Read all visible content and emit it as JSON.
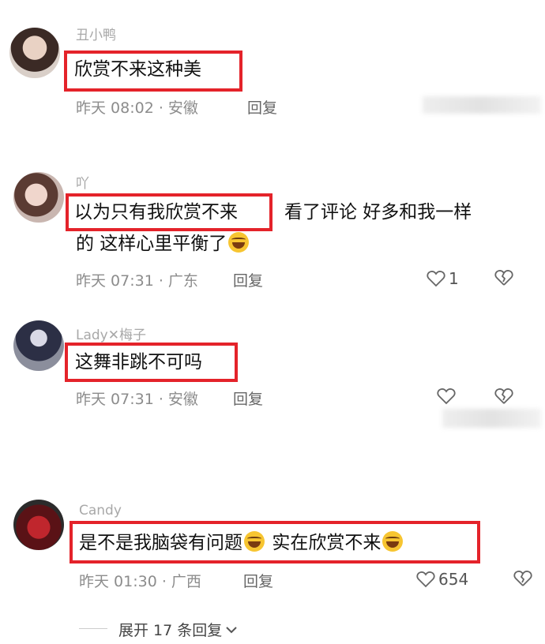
{
  "comments": [
    {
      "username": "丑小鸭",
      "line1_highlight": "欣赏不来这种美",
      "line1_rest": "",
      "line2": "",
      "time": "昨天 08:02 · 安徽",
      "reply_label": "回复",
      "likes": ""
    },
    {
      "username": "吖",
      "line1_highlight": "以为只有我欣赏不来",
      "line1_rest": "看了评论 好多和我一样",
      "line2": "的 这样心里平衡了",
      "time": "昨天 07:31 · 广东",
      "reply_label": "回复",
      "likes": "1"
    },
    {
      "username": "Lady✕梅子",
      "line1_highlight": "这舞非跳不可吗",
      "line1_rest": "",
      "line2": "",
      "time": "昨天 07:31 · 安徽",
      "reply_label": "回复",
      "likes": ""
    },
    {
      "username": "Candy",
      "line1_highlight_a": "是不是我脑袋有问题",
      "line1_highlight_b": "实在欣赏不来",
      "time": "昨天 01:30 · 广西",
      "reply_label": "回复",
      "likes": "654"
    }
  ],
  "expand_label": "展开 17 条回复",
  "icons": {
    "like": "heart-outline-icon",
    "dislike": "broken-heart-icon",
    "emoji": "laughing-tears-emoji",
    "chevron": "chevron-down-icon"
  },
  "colors": {
    "highlight_border": "#e4232a",
    "meta_text": "#8c8c8c"
  }
}
